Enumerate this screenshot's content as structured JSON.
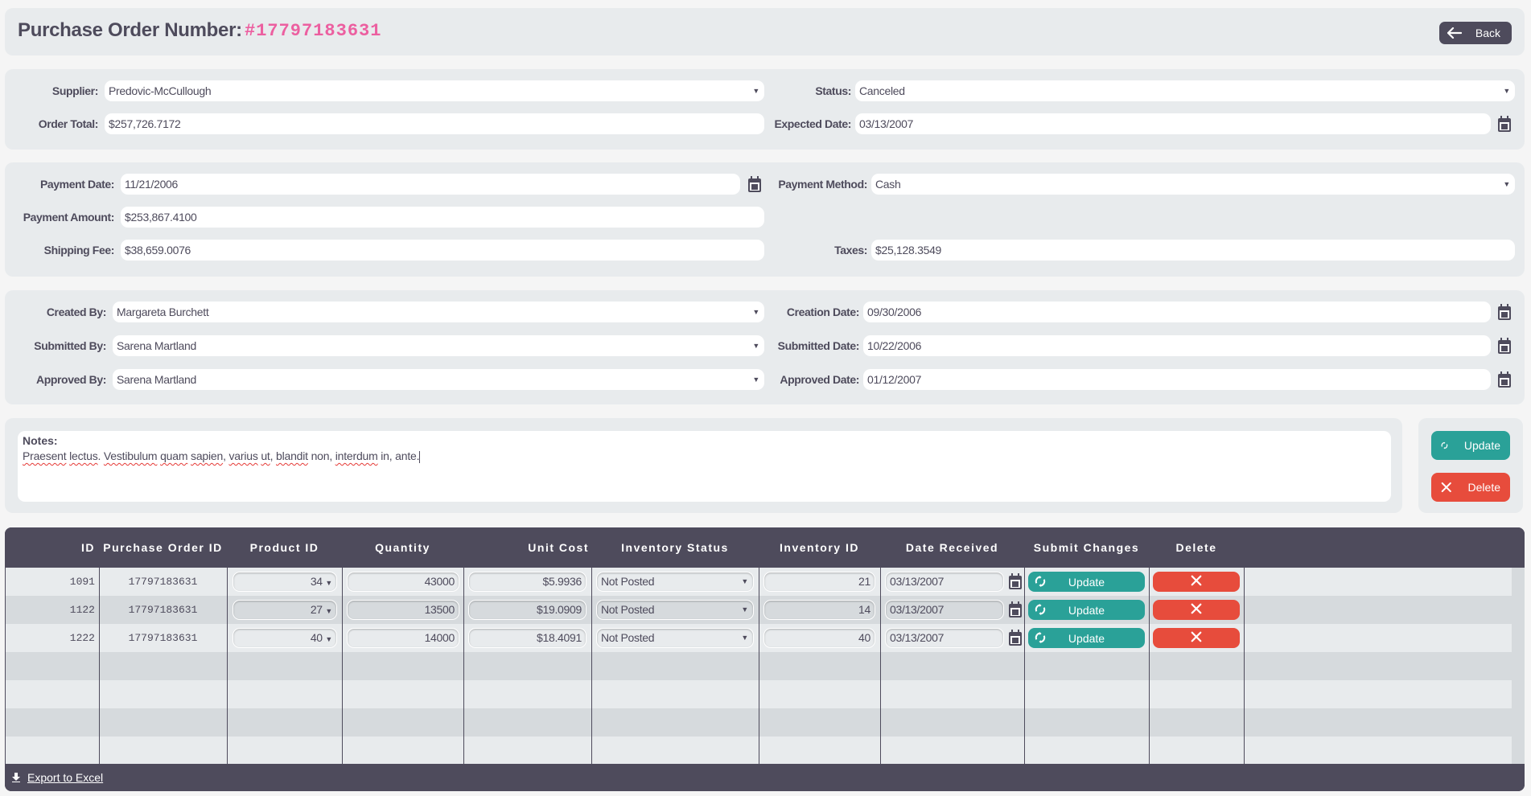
{
  "header": {
    "title": "Purchase Order Number:",
    "po_number": "#17797183631",
    "back_label": "Back"
  },
  "order": {
    "supplier_label": "Supplier:",
    "supplier_value": "Predovic-McCullough",
    "status_label": "Status:",
    "status_value": "Canceled",
    "order_total_label": "Order Total:",
    "order_total_value": "$257,726.7172",
    "expected_date_label": "Expected Date:",
    "expected_date_value": "03/13/2007"
  },
  "payment": {
    "payment_date_label": "Payment Date:",
    "payment_date_value": "11/21/2006",
    "payment_method_label": "Payment Method:",
    "payment_method_value": "Cash",
    "payment_amount_label": "Payment Amount:",
    "payment_amount_value": "$253,867.4100",
    "shipping_fee_label": "Shipping Fee:",
    "shipping_fee_value": "$38,659.0076",
    "taxes_label": "Taxes:",
    "taxes_value": "$25,128.3549"
  },
  "approval": {
    "created_by_label": "Created By:",
    "created_by_value": "Margareta Burchett",
    "creation_date_label": "Creation Date:",
    "creation_date_value": "09/30/2006",
    "submitted_by_label": "Submitted By:",
    "submitted_by_value": "Sarena Martland",
    "submitted_date_label": "Submitted Date:",
    "submitted_date_value": "10/22/2006",
    "approved_by_label": "Approved By:",
    "approved_by_value": "Sarena Martland",
    "approved_date_label": "Approved Date:",
    "approved_date_value": "01/12/2007"
  },
  "notes": {
    "label": "Notes:",
    "words": [
      "Praesent",
      " ",
      "lectus",
      ". ",
      "Vestibulum",
      " ",
      "quam",
      " ",
      "sapien",
      ", ",
      "varius",
      " ",
      "ut",
      ", ",
      "blandit",
      " non, ",
      "interdum",
      " in, ante."
    ]
  },
  "actions": {
    "update_label": "Update",
    "delete_label": "Delete"
  },
  "grid": {
    "columns": [
      "ID",
      "Purchase Order ID",
      "Product ID",
      "Quantity",
      "Unit Cost",
      "Inventory Status",
      "Inventory ID",
      "Date Received",
      "Submit Changes",
      "Delete"
    ],
    "rows": [
      {
        "id": "1091",
        "po_id": "17797183631",
        "product_id": "34",
        "quantity": "43000",
        "unit_cost": "$5.9936",
        "inventory_status": "Not Posted",
        "inventory_id": "21",
        "date_received": "03/13/2007",
        "update_label": "Update"
      },
      {
        "id": "1122",
        "po_id": "17797183631",
        "product_id": "27",
        "quantity": "13500",
        "unit_cost": "$19.0909",
        "inventory_status": "Not Posted",
        "inventory_id": "14",
        "date_received": "03/13/2007",
        "update_label": "Update"
      },
      {
        "id": "1222",
        "po_id": "17797183631",
        "product_id": "40",
        "quantity": "14000",
        "unit_cost": "$18.4091",
        "inventory_status": "Not Posted",
        "inventory_id": "40",
        "date_received": "03/13/2007",
        "update_label": "Update"
      }
    ],
    "export_label": "Export to Excel"
  },
  "colors": {
    "accent_pink": "#ec5fa0",
    "dark": "#4e4b5c",
    "update_teal": "#2aa198",
    "delete_red": "#e74c3c",
    "panel_bg": "#e8ebed"
  }
}
